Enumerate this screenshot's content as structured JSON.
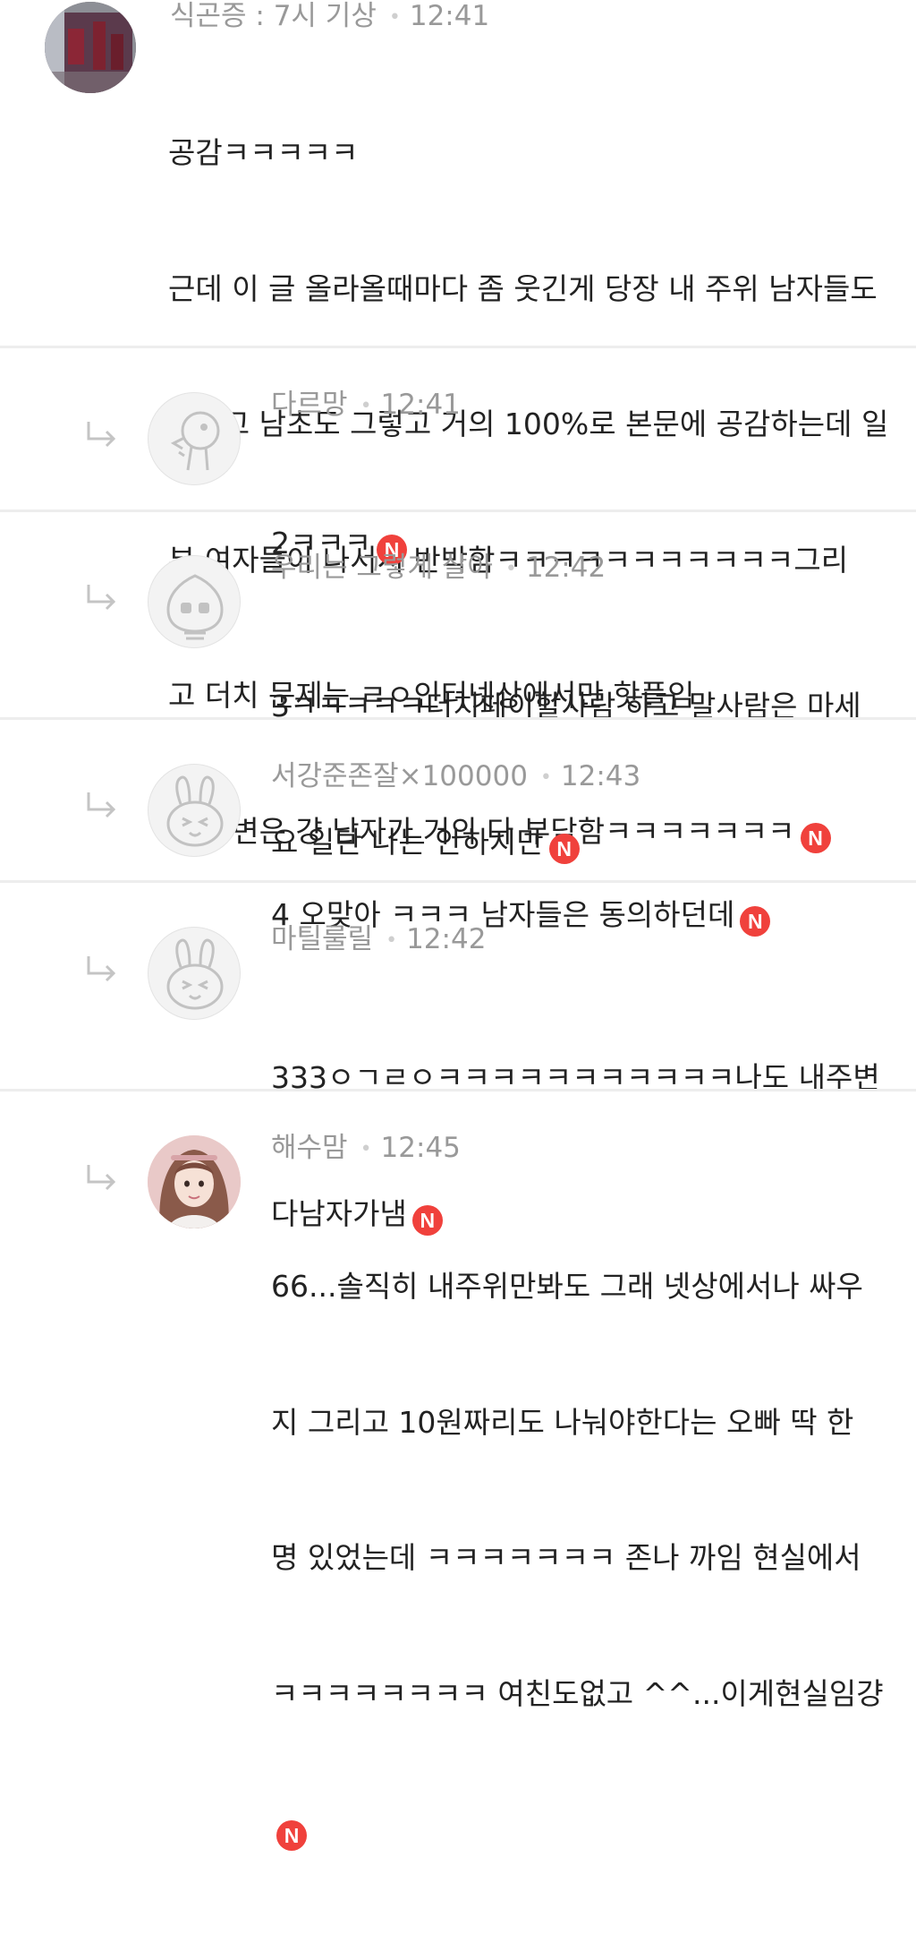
{
  "new_badge": "N",
  "comments": [
    {
      "author": "식곤증 : 7시 기상",
      "time": "12:41",
      "lines": [
        "공감ㅋㅋㅋㅋㅋ",
        "근데 이 글 올라올때마다 좀 웃긴게 당장 내 주위 남자들도",
        "그렇고 남초도 그렇고 거의 100%로 본문에 공감하는데 일",
        "부 여자들이 나서서 반박함ㅋㅋㅋㅋㅋㅋㅋㅋㅋㅋㅋ그리",
        "고 더치 문제는 ㄹㅇ인터넷상에서만 핫플임",
        "내 주변은 걍 남자가 거의 다 부담함ㅋㅋㅋㅋㅋㅋㅋ"
      ]
    },
    {
      "author": "다르망",
      "time": "12:41",
      "lines": [
        "2ㅋㅋㅋ"
      ]
    },
    {
      "author": "우리는 그렇게 살아",
      "time": "12:42",
      "lines": [
        "3ㅋㅋㅋㅋㅋ더치페이할사람 하고 말사람은 마세",
        "요 일단 나는 안하지만"
      ]
    },
    {
      "author": "서강준존잘×100000",
      "time": "12:43",
      "lines": [
        "4 오맞아 ㅋㅋㅋ 남자들은 동의하던데"
      ]
    },
    {
      "author": "마틸룰릴",
      "time": "12:42",
      "lines": [
        "333ㅇㄱㄹㅇㅋㅋㅋㅋㅋㅋㅋㅋㅋㅋㅋ나도 내주변",
        "다남자가냄"
      ]
    },
    {
      "author": "해수맘",
      "time": "12:45",
      "lines": [
        "66...솔직히 내주위만봐도 그래 넷상에서나 싸우",
        "지 그리고 10원짜리도 나눠야한다는 오빠 딱 한",
        "명 있었는데 ㅋㅋㅋㅋㅋㅋㅋ 존나 까임 현실에서",
        "ㅋㅋㅋㅋㅋㅋㅋㅋ 여친도없고 ^^...이게현실임걍",
        ""
      ]
    }
  ]
}
